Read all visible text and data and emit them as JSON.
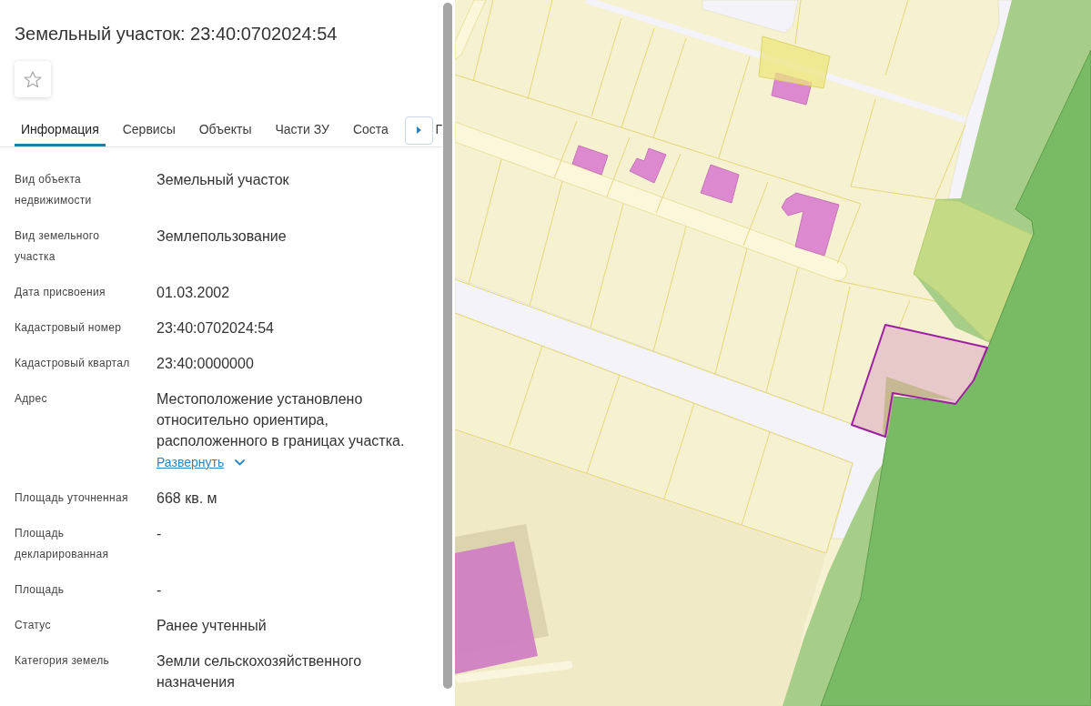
{
  "title": "Земельный участок: 23:40:0702024:54",
  "favorite": false,
  "tabs": [
    {
      "label": "Информация",
      "selected": true
    },
    {
      "label": "Сервисы",
      "selected": false
    },
    {
      "label": "Объекты",
      "selected": false
    },
    {
      "label": "Части ЗУ",
      "selected": false
    },
    {
      "label": "Соста",
      "selected": false
    },
    {
      "label": "Г",
      "selected": false
    }
  ],
  "fields": [
    {
      "label": "Вид объекта недвижимости",
      "value": "Земельный участок"
    },
    {
      "label": "Вид земельного участка",
      "value": "Землепользование"
    },
    {
      "label": "Дата присвоения",
      "value": "01.03.2002"
    },
    {
      "label": "Кадастровый номер",
      "value": "23:40:0702024:54"
    },
    {
      "label": "Кадастровый квартал",
      "value": "23:40:0000000"
    },
    {
      "label": "Адрес",
      "value": "Местоположение установлено относительно ориентира, расположенного в границах участка.",
      "link": {
        "label": "Развернуть",
        "expanded": false
      }
    },
    {
      "label": "Площадь уточненная",
      "value": "668 кв. м"
    },
    {
      "label": "Площадь декларированная",
      "value": "-"
    },
    {
      "label": "Площадь",
      "value": "-"
    },
    {
      "label": "Статус",
      "value": "Ранее учтенный"
    },
    {
      "label": "Категория земель",
      "value": "Земли сельскохозяйственного назначения"
    }
  ]
}
